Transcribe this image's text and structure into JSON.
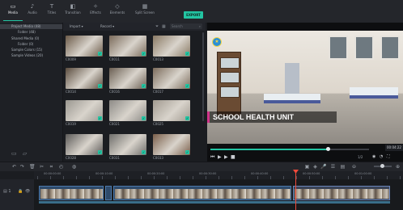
{
  "toolbar": {
    "tabs": [
      {
        "label": "Media",
        "icon": "folder-icon"
      },
      {
        "label": "Audio",
        "icon": "music-note-icon"
      },
      {
        "label": "Titles",
        "icon": "text-t-icon"
      },
      {
        "label": "Transition",
        "icon": "transition-icon"
      },
      {
        "label": "Effects",
        "icon": "effects-icon"
      },
      {
        "label": "Elements",
        "icon": "elements-icon"
      },
      {
        "label": "Split Screen",
        "icon": "split-screen-icon"
      }
    ],
    "export_label": "EXPORT"
  },
  "folders": [
    {
      "label": "Project Media (48)",
      "selected": true
    },
    {
      "label": "Folder (48)",
      "selected": false
    },
    {
      "label": "Shared Media (0)",
      "selected": false
    },
    {
      "label": "Folder (0)",
      "selected": false
    },
    {
      "label": "Sample Colors (15)",
      "selected": false
    },
    {
      "label": "Sample Videos (20)",
      "selected": false
    }
  ],
  "media": {
    "import_label": "Import",
    "record_label": "Record",
    "search_placeholder": "Search",
    "clips": [
      {
        "name": "C0009",
        "tone": "#6b5a48"
      },
      {
        "name": "C0011",
        "tone": "#7a6a5a"
      },
      {
        "name": "C0013",
        "tone": "#8a7a64"
      },
      {
        "name": "C0014",
        "tone": "#5a4c3e"
      },
      {
        "name": "C0016",
        "tone": "#6a5e52"
      },
      {
        "name": "C0017",
        "tone": "#7c6c5c"
      },
      {
        "name": "C0019",
        "tone": "#9a9790"
      },
      {
        "name": "C0021",
        "tone": "#8c8a86"
      },
      {
        "name": "C0025",
        "tone": "#a19a90"
      },
      {
        "name": "C0028",
        "tone": "#5c5a58"
      },
      {
        "name": "C0031",
        "tone": "#6e6d6a"
      },
      {
        "name": "C0033",
        "tone": "#7a5e4a"
      }
    ]
  },
  "preview": {
    "caption": "SCHOOL HEALTH UNIT",
    "progress": 0.74,
    "timecode": "00:04:22",
    "ratio": "1/2"
  },
  "timeline": {
    "ruler_labels": [
      "00:00:00:00",
      "00:00:10:00",
      "00:00:20:00",
      "00:00:30:00",
      "00:00:40:00",
      "00:00:50:00",
      "00:01:00:00"
    ],
    "zoom_level": 0.45
  },
  "colors": {
    "accent": "#23c4a2",
    "playhead": "#f04a3a",
    "caption_accent": "#d0348a"
  }
}
